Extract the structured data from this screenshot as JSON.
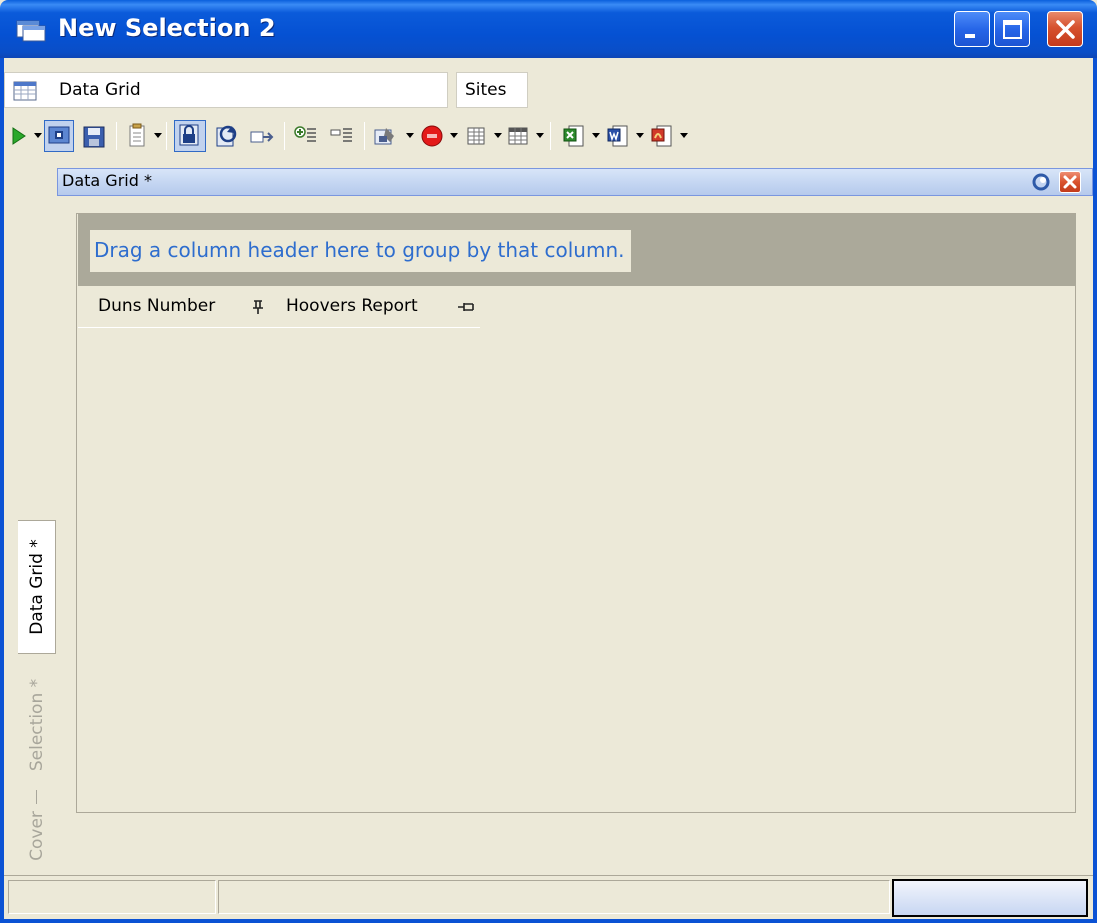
{
  "window": {
    "title": "New Selection 2",
    "controls": {
      "minimize": "minimize",
      "maximize": "maximize",
      "close": "close"
    }
  },
  "tabs": [
    {
      "label": "Data Grid",
      "icon": "grid-icon"
    },
    {
      "label": "Sites"
    }
  ],
  "toolbar": {
    "buttons": [
      "run-icon",
      "open-icon",
      "save-icon",
      "notes-icon",
      "lock-icon",
      "refresh-icon",
      "export-arrow-icon",
      "add-column-icon",
      "remove-column-icon",
      "properties-icon",
      "stop-icon",
      "columns-icon",
      "grid-table-icon",
      "excel-icon",
      "word-icon",
      "pdf-icon"
    ]
  },
  "panel": {
    "title": "Data Grid *"
  },
  "side_tabs": [
    {
      "label": "Data Grid *",
      "active": true
    },
    {
      "label": "Selection *",
      "active": false
    },
    {
      "label": "Cover",
      "active": false
    }
  ],
  "grid": {
    "group_hint": "Drag a column header here to group by that column.",
    "columns": [
      {
        "label": "Duns Number"
      },
      {
        "label": "Hoovers Report"
      }
    ]
  },
  "colors": {
    "title_bar": "#0551D3",
    "group_hint_text": "#2E6DCE",
    "face": "#ECE9D8"
  }
}
